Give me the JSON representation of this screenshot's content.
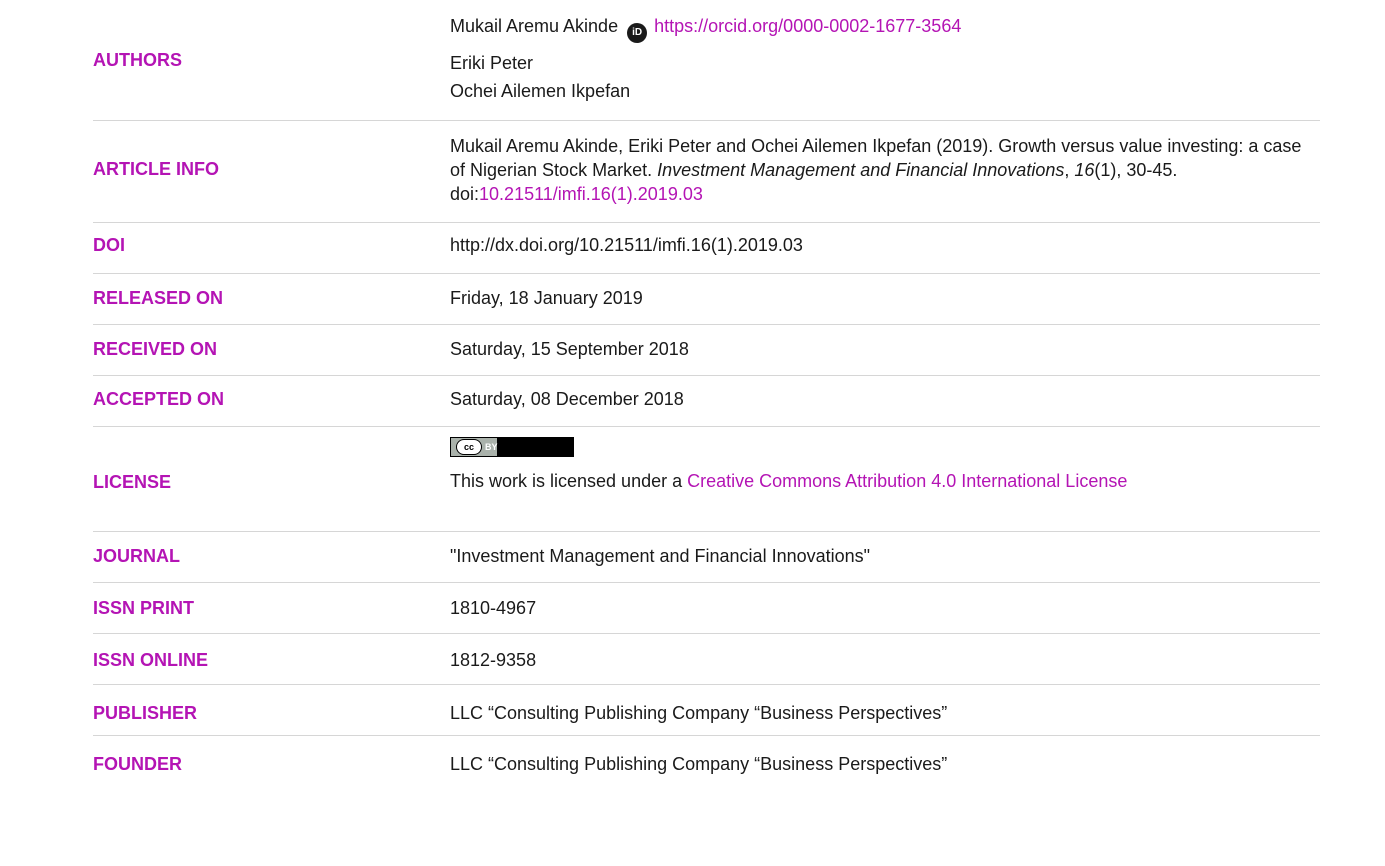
{
  "rows": {
    "authors": {
      "label": "AUTHORS",
      "names": [
        "Mukail Aremu Akinde",
        "Eriki Peter",
        "Ochei Ailemen Ikpefan"
      ],
      "orcid_url": "https://orcid.org/0000-0002-1677-3564",
      "orcid_icon": "orcid-icon"
    },
    "article_info": {
      "label": "ARTICLE INFO",
      "citation_prefix": "Mukail Aremu Akinde, Eriki Peter and Ochei Ailemen Ikpefan (2019). Growth versus value investing: a case of Nigerian Stock Market. ",
      "journal_italic": "Investment Management and Financial Innovations",
      "sep1": ", ",
      "volume_italic": "16",
      "citation_suffix": "(1), 30-45. doi:",
      "doi_link": "10.21511/imfi.16(1).2019.03"
    },
    "doi": {
      "label": "DOI",
      "value": "http://dx.doi.org/10.21511/imfi.16(1).2019.03"
    },
    "released_on": {
      "label": "RELEASED ON",
      "value": "Friday, 18 January 2019"
    },
    "received_on": {
      "label": "RECEIVED ON",
      "value": "Saturday, 15 September 2018"
    },
    "accepted_on": {
      "label": "ACCEPTED ON",
      "value": "Saturday, 08 December 2018"
    },
    "license": {
      "label": "LICENSE",
      "badge_cc": "cc",
      "badge_by": "BY",
      "text_prefix": "This work is licensed under a ",
      "link_text": "Creative Commons Attribution 4.0 International License"
    },
    "journal": {
      "label": "JOURNAL",
      "value": "\"Investment Management and Financial Innovations\""
    },
    "issn_print": {
      "label": "ISSN PRINT",
      "value": "1810-4967"
    },
    "issn_online": {
      "label": "ISSN ONLINE",
      "value": "1812-9358"
    },
    "publisher": {
      "label": "PUBLISHER",
      "value": "LLC “Consulting Publishing Company “Business Perspectives”"
    },
    "founder": {
      "label": "FOUNDER",
      "value": "LLC “Consulting Publishing Company “Business Perspectives”"
    }
  },
  "colors": {
    "label": "#b414b4",
    "link": "#b414b4",
    "text": "#1a1a1a",
    "divider": "#d6d6d6"
  }
}
